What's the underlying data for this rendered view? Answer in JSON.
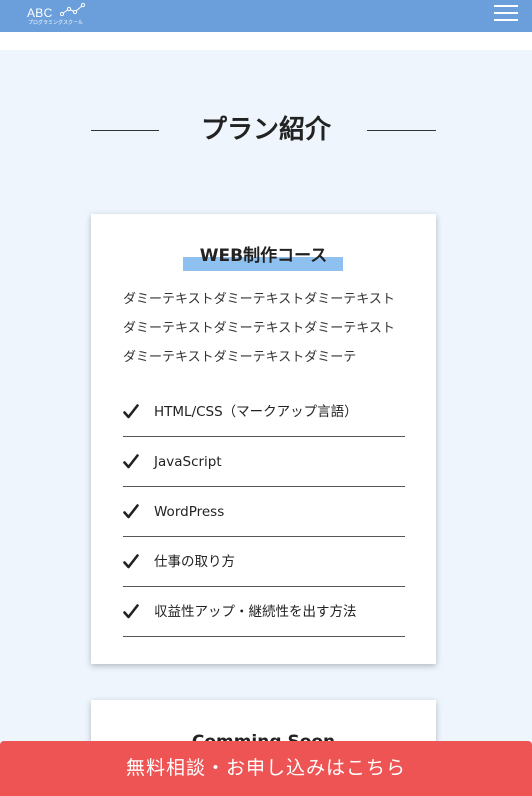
{
  "header": {
    "logo_text": "ABC",
    "logo_sub": "プログラミングスクール",
    "menu_icon": "hamburger-menu-icon",
    "bg_color": "#6a9fdb"
  },
  "plan_section": {
    "title": "プラン紹介",
    "bg_color": "#eef5fd"
  },
  "course": {
    "title": "WEB制作コース",
    "description": "ダミーテキストダミーテキストダミーテキストダミーテキストダミーテキストダミーテキストダミーテキストダミーテキストダミーテ",
    "check_icon": "checkmark-icon",
    "features": [
      {
        "label": "HTML/CSS（マークアップ言語）"
      },
      {
        "label": "JavaScript"
      },
      {
        "label": "WordPress"
      },
      {
        "label": "仕事の取り方"
      },
      {
        "label": "収益性アップ・継続性を出す方法"
      }
    ]
  },
  "course2": {
    "title": "Comming Soon"
  },
  "cta": {
    "label": "無料相談・お申し込みはこちら",
    "color": "#ee5454"
  }
}
